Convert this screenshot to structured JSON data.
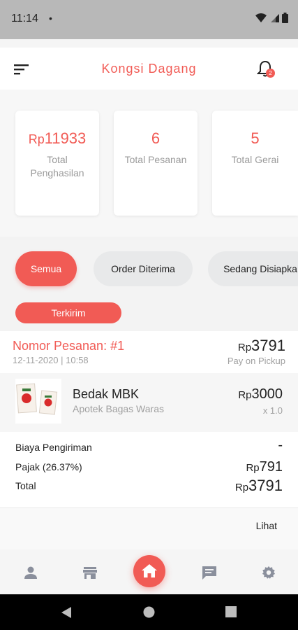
{
  "status_bar": {
    "time": "11:14",
    "dot": "•"
  },
  "header": {
    "title": "Kongsi Dagang",
    "notification_count": "2"
  },
  "stats": [
    {
      "currency": "Rp",
      "value": "11933",
      "label": "Total Penghasilan"
    },
    {
      "currency": "",
      "value": "6",
      "label": "Total Pesanan"
    },
    {
      "currency": "",
      "value": "5",
      "label": "Total Gerai"
    }
  ],
  "filters": {
    "semua": "Semua",
    "order_diterima": "Order Diterima",
    "sedang_disiapkan": "Sedang Disiapka",
    "terkirim": "Terkirim"
  },
  "order": {
    "title": "Nomor Pesanan: #1",
    "date": "12-11-2020 | 10:58",
    "total_currency": "Rp",
    "total_value": "3791",
    "payment": "Pay on Pickup",
    "item": {
      "name": "Bedak MBK",
      "store": "Apotek Bagas Waras",
      "price_currency": "Rp",
      "price_value": "3000",
      "qty": "x 1.0"
    },
    "summary": {
      "shipping_label": "Biaya Pengiriman",
      "shipping_value": "-",
      "tax_label": "Pajak (26.37%)",
      "tax_currency": "Rp",
      "tax_value": "791",
      "total_label": "Total",
      "total_currency": "Rp",
      "total_value": "3791"
    },
    "view_link": "Lihat"
  },
  "colors": {
    "accent": "#f15b55",
    "icon_gray": "#8a8f9c"
  },
  "icons": [
    "person-icon",
    "store-icon",
    "home-icon",
    "chat-icon",
    "settings-icon"
  ]
}
